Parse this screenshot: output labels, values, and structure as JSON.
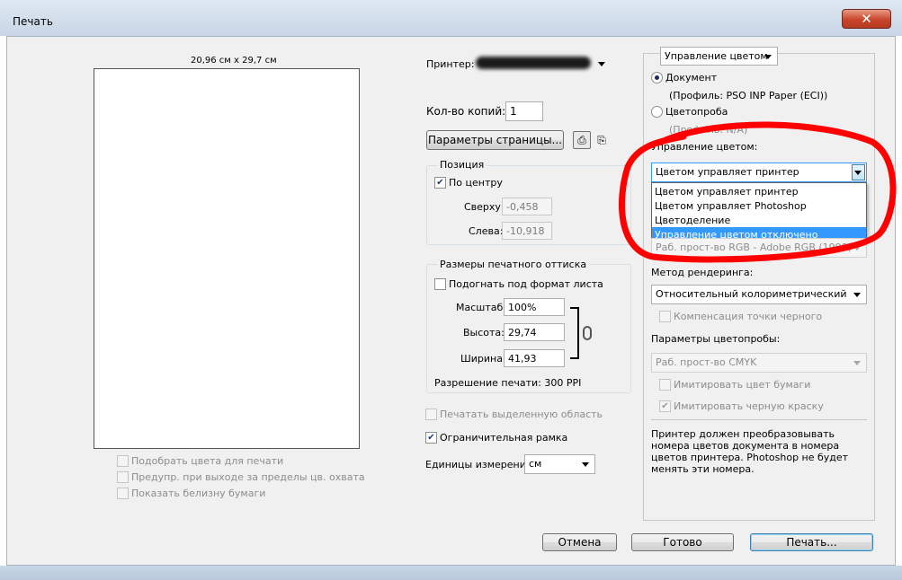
{
  "window": {
    "title": "Печать",
    "close_symbol": "✕"
  },
  "preview": {
    "size_label": "20,96 см x 29,7 см",
    "checkboxes": [
      {
        "label": "Подобрать цвета для печати",
        "checked": false,
        "enabled": false
      },
      {
        "label": "Предупр. при выходе за пределы цв. охвата",
        "checked": false,
        "enabled": false
      },
      {
        "label": "Показать белизну бумаги",
        "checked": false,
        "enabled": false
      }
    ]
  },
  "printer": {
    "label": "Принтер:"
  },
  "copies": {
    "label": "Кол-во копий:",
    "value": "1"
  },
  "page_setup": {
    "button_label": "Параметры страницы...",
    "portrait_icon": "portrait-orientation-icon",
    "landscape_icon": "landscape-orientation-icon"
  },
  "position": {
    "legend": "Позиция",
    "center_label": "По центру",
    "center_checked": true,
    "top_label": "Сверху:",
    "top_value": "-0,458",
    "left_label": "Слева:",
    "left_value": "-10,918"
  },
  "print_size": {
    "legend": "Размеры печатного оттиска",
    "fit_label": "Подогнать под формат листа",
    "fit_checked": false,
    "scale_label": "Масштаб:",
    "scale_value": "100%",
    "height_label": "Высота:",
    "height_value": "29,74",
    "width_label": "Ширина:",
    "width_value": "41,93",
    "resolution_text": "Разрешение печати: 300 PPI"
  },
  "options": {
    "print_selected_label": "Печатать выделенную область",
    "print_selected_checked": false,
    "bounding_box_label": "Ограничительная рамка",
    "bounding_box_checked": true,
    "units_label": "Единицы измерения:",
    "units_value": "см"
  },
  "color": {
    "mode_select": "Управление цветом",
    "document_label": "Документ",
    "document_profile": "(Профиль: PSO INP Paper (ECI))",
    "proof_label": "Цветопроба",
    "proof_profile": "(Профиль: N/A)",
    "handling_label": "Управление цветом:",
    "handling_value": "Цветом управляет принтер",
    "handling_options": [
      "Цветом управляет принтер",
      "Цветом управляет Photoshop",
      "Цветоделение",
      "Управление цветом отключено"
    ],
    "highlighted_option": 3,
    "profile_value": "Раб. прост-во RGB - Adobe RGB (1998)",
    "intent_label": "Метод рендеринга:",
    "intent_value": "Относительный колориметрический",
    "bpc_label": "Компенсация точки черного",
    "proof_setup_label": "Параметры цветопробы:",
    "proof_setup_value": "Раб. прост-во CMYK",
    "sim_paper_label": "Имитировать цвет бумаги",
    "sim_ink_label": "Имитировать черную краску",
    "description": "Принтер должен преобразовывать номера цветов документа в номера цветов принтера. Photoshop не будет менять эти номера."
  },
  "buttons": {
    "cancel": "Отмена",
    "done": "Готово",
    "print": "Печать..."
  },
  "annotation_color": "#ff0000"
}
